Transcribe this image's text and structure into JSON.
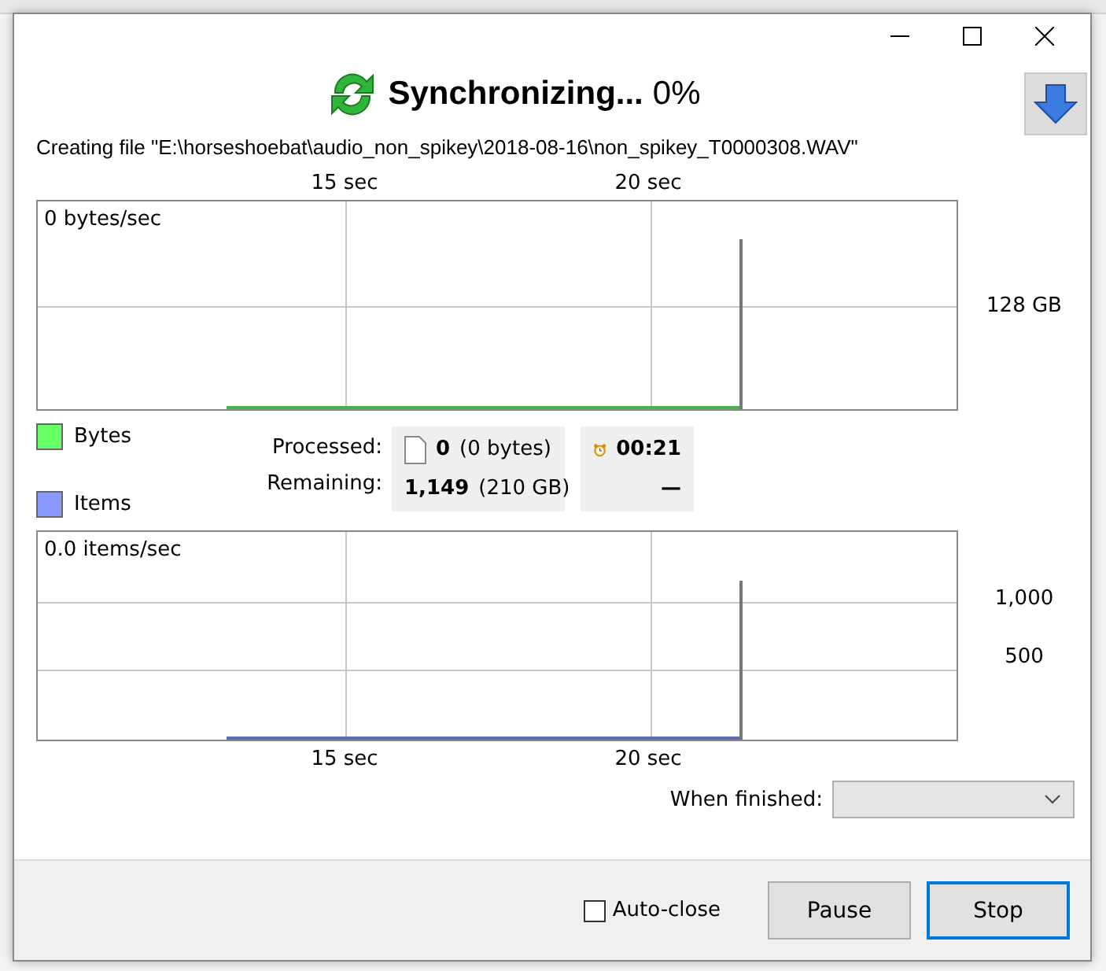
{
  "header": {
    "title": "Synchronizing...",
    "percent": "0%"
  },
  "status_text": "Creating file \"E:\\horseshoebat\\audio_non_spikey\\2018-08-16\\non_spikey_T0000308.WAV\"",
  "bytes_graph": {
    "rate": "0 bytes/sec",
    "x_ticks": [
      "15 sec",
      "20 sec"
    ],
    "y_labels": [
      "128 GB"
    ]
  },
  "legend": [
    {
      "label": "Bytes",
      "color": "#66ff66"
    },
    {
      "label": "Items",
      "color": "#8899ff"
    }
  ],
  "stats": {
    "processed_label": "Processed:",
    "processed_count": "0",
    "processed_size": "(0 bytes)",
    "remaining_label": "Remaining:",
    "remaining_count": "1,149",
    "remaining_size": "(210 GB)",
    "elapsed_time": "00:21",
    "remaining_time": "—"
  },
  "items_graph": {
    "rate": "0.0 items/sec",
    "x_ticks": [
      "15 sec",
      "20 sec"
    ],
    "y_labels": [
      "1,000",
      "500"
    ]
  },
  "when_finished": {
    "label": "When finished:"
  },
  "auto_close": {
    "label": "Auto-close",
    "checked": false
  },
  "buttons": [
    {
      "label": "Pause",
      "focused": false
    },
    {
      "label": "Stop",
      "focused": true
    }
  ]
}
